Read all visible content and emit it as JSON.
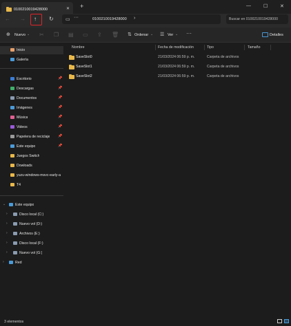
{
  "window": {
    "tab_title": "0100210019428000",
    "new_tab": "+",
    "minimize": "—",
    "maximize": "☐",
    "close": "✕"
  },
  "nav": {
    "back": "←",
    "forward": "→",
    "up": "↑",
    "refresh": "↻",
    "monitor_icon": "▭",
    "more": "···",
    "breadcrumb": "0100210019428000",
    "breadcrumb_chevron": "›",
    "search_placeholder": "Buscar en 0100210019428000"
  },
  "toolbar": {
    "new_label": "Nuevo",
    "sort_label": "Ordenar",
    "view_label": "Ver",
    "more": "···",
    "details_label": "Detalles"
  },
  "sidebar": {
    "items": [
      {
        "label": "Inicio",
        "color": "#e8a06a"
      },
      {
        "label": "Galería",
        "color": "#4a9ad8"
      },
      {
        "label": "Escritorio",
        "color": "#3a7dd6"
      },
      {
        "label": "Descargas",
        "color": "#3fb06a"
      },
      {
        "label": "Documentos",
        "color": "#8a9bb0"
      },
      {
        "label": "Imágenes",
        "color": "#4a9ad8"
      },
      {
        "label": "Música",
        "color": "#e06090"
      },
      {
        "label": "Videos",
        "color": "#9a5ad8"
      },
      {
        "label": "Papelera de reciclaje",
        "color": "#9a9a9a"
      },
      {
        "label": "Este equipo",
        "color": "#4a9ad8"
      },
      {
        "label": "Juegos Switch",
        "color": "#e8b84a"
      },
      {
        "label": "Dowloads",
        "color": "#e8b84a"
      },
      {
        "label": "yuzu-windows-msvc-early-a",
        "color": "#e8b84a"
      },
      {
        "label": "T4",
        "color": "#e8b84a"
      }
    ],
    "this_pc": "Este equipo",
    "drives": [
      {
        "label": "Disco local (C:)"
      },
      {
        "label": "Nuevo vol (D:)"
      },
      {
        "label": "Archivos (E:)"
      },
      {
        "label": "Disco local (F:)"
      },
      {
        "label": "Nuevo vol (G:)"
      }
    ],
    "network": "Red"
  },
  "columns": {
    "name": "Nombre",
    "modified": "Fecha de modificación",
    "type": "Tipo",
    "size": "Tamaño"
  },
  "files": [
    {
      "name": "SaveSlot0",
      "modified": "21/03/2024 06:59 p. m.",
      "type": "Carpeta de archivos",
      "size": ""
    },
    {
      "name": "SaveSlot1",
      "modified": "21/03/2024 06:59 p. m.",
      "type": "Carpeta de archivos",
      "size": ""
    },
    {
      "name": "SaveSlot2",
      "modified": "21/03/2024 06:59 p. m.",
      "type": "Carpeta de archivos",
      "size": ""
    }
  ],
  "status": {
    "count": "3 elementos"
  },
  "colors": {
    "accent": "#4a9ad8",
    "folder": "#e8b84a",
    "highlight_box": "#e0242b"
  }
}
